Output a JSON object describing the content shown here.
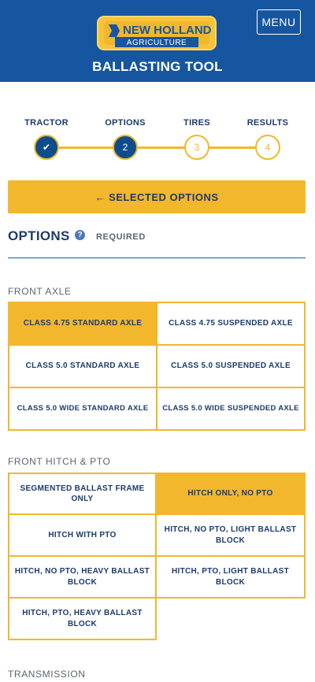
{
  "header": {
    "logo_main": "NEW HOLLAND",
    "logo_sub": "AGRICULTURE",
    "menu_label": "MENU",
    "title": "BALLASTING TOOL"
  },
  "stepper": {
    "steps": [
      {
        "label": "TRACTOR",
        "marker": "✔",
        "state": "done"
      },
      {
        "label": "OPTIONS",
        "marker": "2",
        "state": "current"
      },
      {
        "label": "TIRES",
        "marker": "3",
        "state": "todo"
      },
      {
        "label": "RESULTS",
        "marker": "4",
        "state": "todo"
      }
    ]
  },
  "selected_options_label": "← SELECTED OPTIONS",
  "options": {
    "title": "OPTIONS",
    "help_icon": "?",
    "required": "REQUIRED"
  },
  "sections": [
    {
      "label": "FRONT AXLE",
      "choices": [
        {
          "label": "CLASS 4.75 STANDARD AXLE",
          "selected": true
        },
        {
          "label": "CLASS 4.75 SUSPENDED AXLE",
          "selected": false
        },
        {
          "label": "CLASS 5.0 STANDARD AXLE",
          "selected": false
        },
        {
          "label": "CLASS 5.0 SUSPENDED AXLE",
          "selected": false
        },
        {
          "label": "CLASS 5.0 WIDE STANDARD AXLE",
          "selected": false
        },
        {
          "label": "CLASS 5.0 WIDE SUSPENDED AXLE",
          "selected": false
        }
      ]
    },
    {
      "label": "FRONT HITCH & PTO",
      "choices": [
        {
          "label": "SEGMENTED BALLAST FRAME ONLY",
          "selected": false
        },
        {
          "label": "HITCH ONLY, NO PTO",
          "selected": true
        },
        {
          "label": "HITCH WITH PTO",
          "selected": false
        },
        {
          "label": "HITCH, NO PTO, LIGHT BALLAST BLOCK",
          "selected": false
        },
        {
          "label": "HITCH, NO PTO, HEAVY BALLAST BLOCK",
          "selected": false
        },
        {
          "label": "HITCH, PTO, LIGHT BALLAST BLOCK",
          "selected": false
        },
        {
          "label": "HITCH, PTO, HEAVY BALLAST BLOCK",
          "selected": false
        }
      ]
    },
    {
      "label": "TRANSMISSION",
      "choices": []
    }
  ],
  "colors": {
    "brand_blue": "#1656a0",
    "accent_yellow": "#f2b72c",
    "text_navy": "#1d3a6b"
  }
}
